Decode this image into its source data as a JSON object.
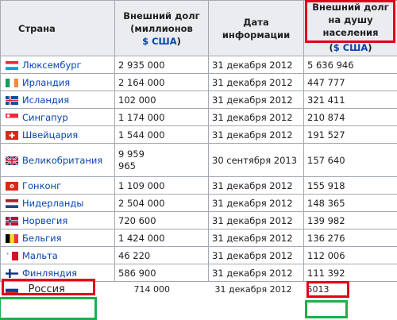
{
  "headers": {
    "country": "Страна",
    "debt_line1": "Внешний долг",
    "debt_line2": "(миллионов",
    "debt_link": "$ США",
    "debt_close": ")",
    "date_line1": "Дата",
    "date_line2": "информации",
    "percap_line1": "Внешний долг",
    "percap_line2": "на душу",
    "percap_line3": "населения",
    "percap_link": "$ США",
    "percap_link_pre": "(",
    "percap_link_post": ")"
  },
  "rows": [
    {
      "country": "Люксембург",
      "flag": "luxembourg-flag",
      "debt": "2 935 000",
      "date": "31 декабря 2012",
      "per_capita": "5 636 946"
    },
    {
      "country": "Ирландия",
      "flag": "ireland-flag",
      "debt": "2 164 000",
      "date": "31 декабря 2012",
      "per_capita": "447 777"
    },
    {
      "country": "Исландия",
      "flag": "iceland-flag",
      "debt": "102 000",
      "date": "31 декабря 2012",
      "per_capita": "321 411"
    },
    {
      "country": "Сингапур",
      "flag": "singapore-flag",
      "debt": "1 174 000",
      "date": "31 декабря 2012",
      "per_capita": "210 874"
    },
    {
      "country": "Швейцария",
      "flag": "switzerland-flag",
      "debt": "1 544 000",
      "date": "31 декабря 2012",
      "per_capita": "191 527"
    },
    {
      "country": "Великобритания",
      "flag": "uk-flag",
      "debt": "9 959 965",
      "date": "30 сентября 2013",
      "per_capita": "157 640"
    },
    {
      "country": "Гонконг",
      "flag": "hongkong-flag",
      "debt": "1 109 000",
      "date": "31 декабря 2012",
      "per_capita": "155 918"
    },
    {
      "country": "Нидерланды",
      "flag": "netherlands-flag",
      "debt": "2 504 000",
      "date": "31 декабря 2012",
      "per_capita": "148 365"
    },
    {
      "country": "Норвегия",
      "flag": "norway-flag",
      "debt": "720 600",
      "date": "31 декабря 2012",
      "per_capita": "139 982"
    },
    {
      "country": "Бельгия",
      "flag": "belgium-flag",
      "debt": "1 424 000",
      "date": "31 декабря 2012",
      "per_capita": "136 276"
    },
    {
      "country": "Мальта",
      "flag": "malta-flag",
      "debt": "46 220",
      "date": "31 декабря 2012",
      "per_capita": "112 006"
    },
    {
      "country": "Финляндия",
      "flag": "finland-flag",
      "debt": "586 900",
      "date": "31 декабря 2012",
      "per_capita": "111 392"
    },
    {
      "country": "Россия",
      "flag": "russia-flag",
      "debt": "714 000",
      "date": "31 декабря 2012",
      "per_capita": "5013"
    }
  ],
  "uk_debt_parts": [
    "9 959",
    "965"
  ],
  "colors": {
    "highlight_red": "#e0001b",
    "highlight_green": "#1fae4b",
    "link_blue": "#0645ad",
    "header_bg": "#eaecf0"
  }
}
